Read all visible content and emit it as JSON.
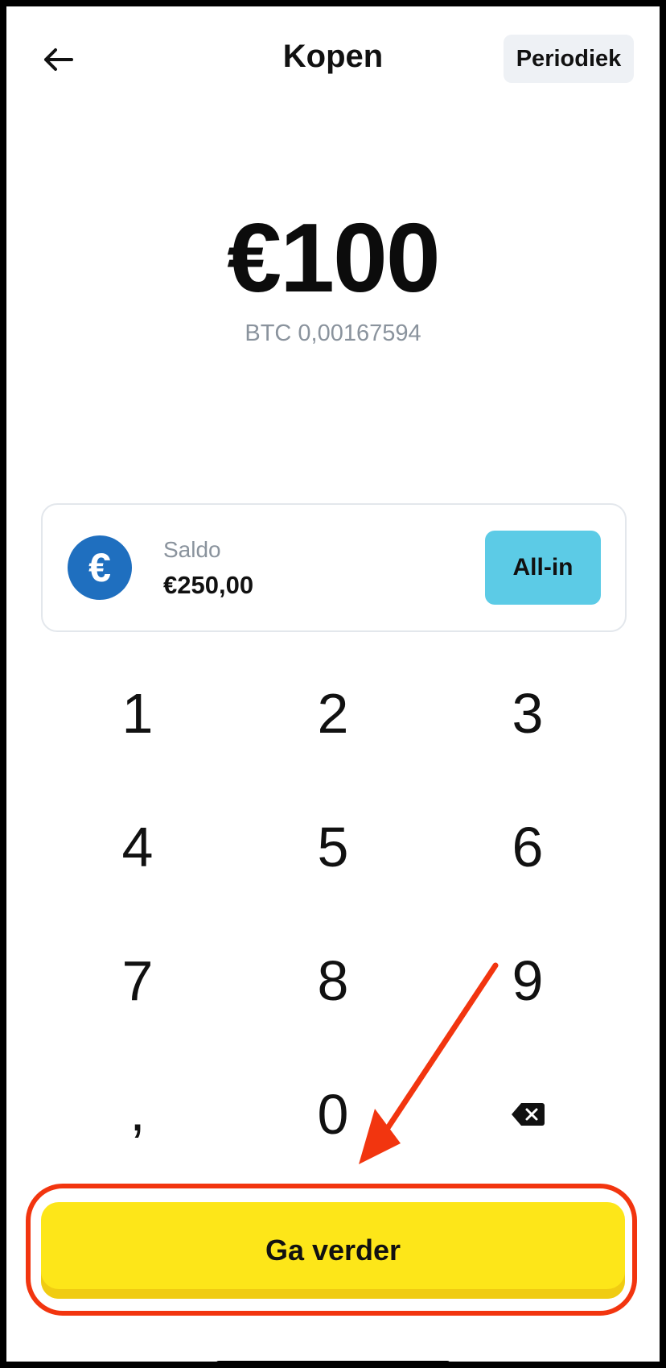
{
  "header": {
    "title": "Kopen",
    "periodic_label": "Periodiek"
  },
  "amount": {
    "value": "€100",
    "crypto_equivalent": "BTC 0,00167594"
  },
  "balance": {
    "label": "Saldo",
    "value": "€250,00",
    "currency_symbol": "€",
    "all_in_label": "All-in"
  },
  "keypad": {
    "keys": [
      "1",
      "2",
      "3",
      "4",
      "5",
      "6",
      "7",
      "8",
      "9",
      ",",
      "0"
    ]
  },
  "actions": {
    "continue_label": "Ga verder"
  },
  "colors": {
    "accent_yellow": "#fde619",
    "all_in_cyan": "#5ccbe6",
    "euro_blue": "#1f6fbf",
    "annotation_red": "#f2350f"
  }
}
